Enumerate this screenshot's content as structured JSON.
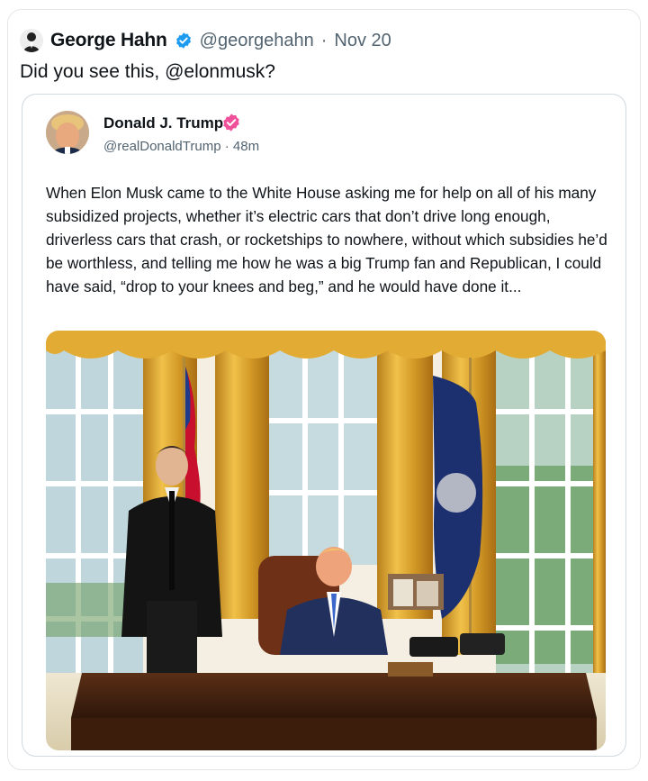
{
  "tweet": {
    "author_name": "George Hahn",
    "handle": "@georgehahn",
    "separator": "·",
    "date": "Nov 20",
    "text": "Did you see this, @elonmusk?",
    "verified_color": "#1d9bf0"
  },
  "quoted_tweet": {
    "author_name": "Donald J. Trump",
    "handle": "@realDonaldTrump",
    "separator": "·",
    "time": "48m",
    "badge_color": "#f0509a",
    "body": "When Elon Musk came to the White House asking me for help on all of his many subsidized projects, whether it’s electric cars that don’t drive long enough, driverless cars that crash, or rocketships to nowhere, without which subsidies he’d be worthless, and telling me how he was a big Trump fan and Republican, I could have said, “drop to your knees and beg,” and he would have done it..."
  },
  "icons": {
    "verified": "verified-badge-icon",
    "quoted_badge": "verified-badge-icon"
  },
  "colors": {
    "text": "#0f1419",
    "secondary_text": "#536471",
    "border": "#cfd9de"
  }
}
